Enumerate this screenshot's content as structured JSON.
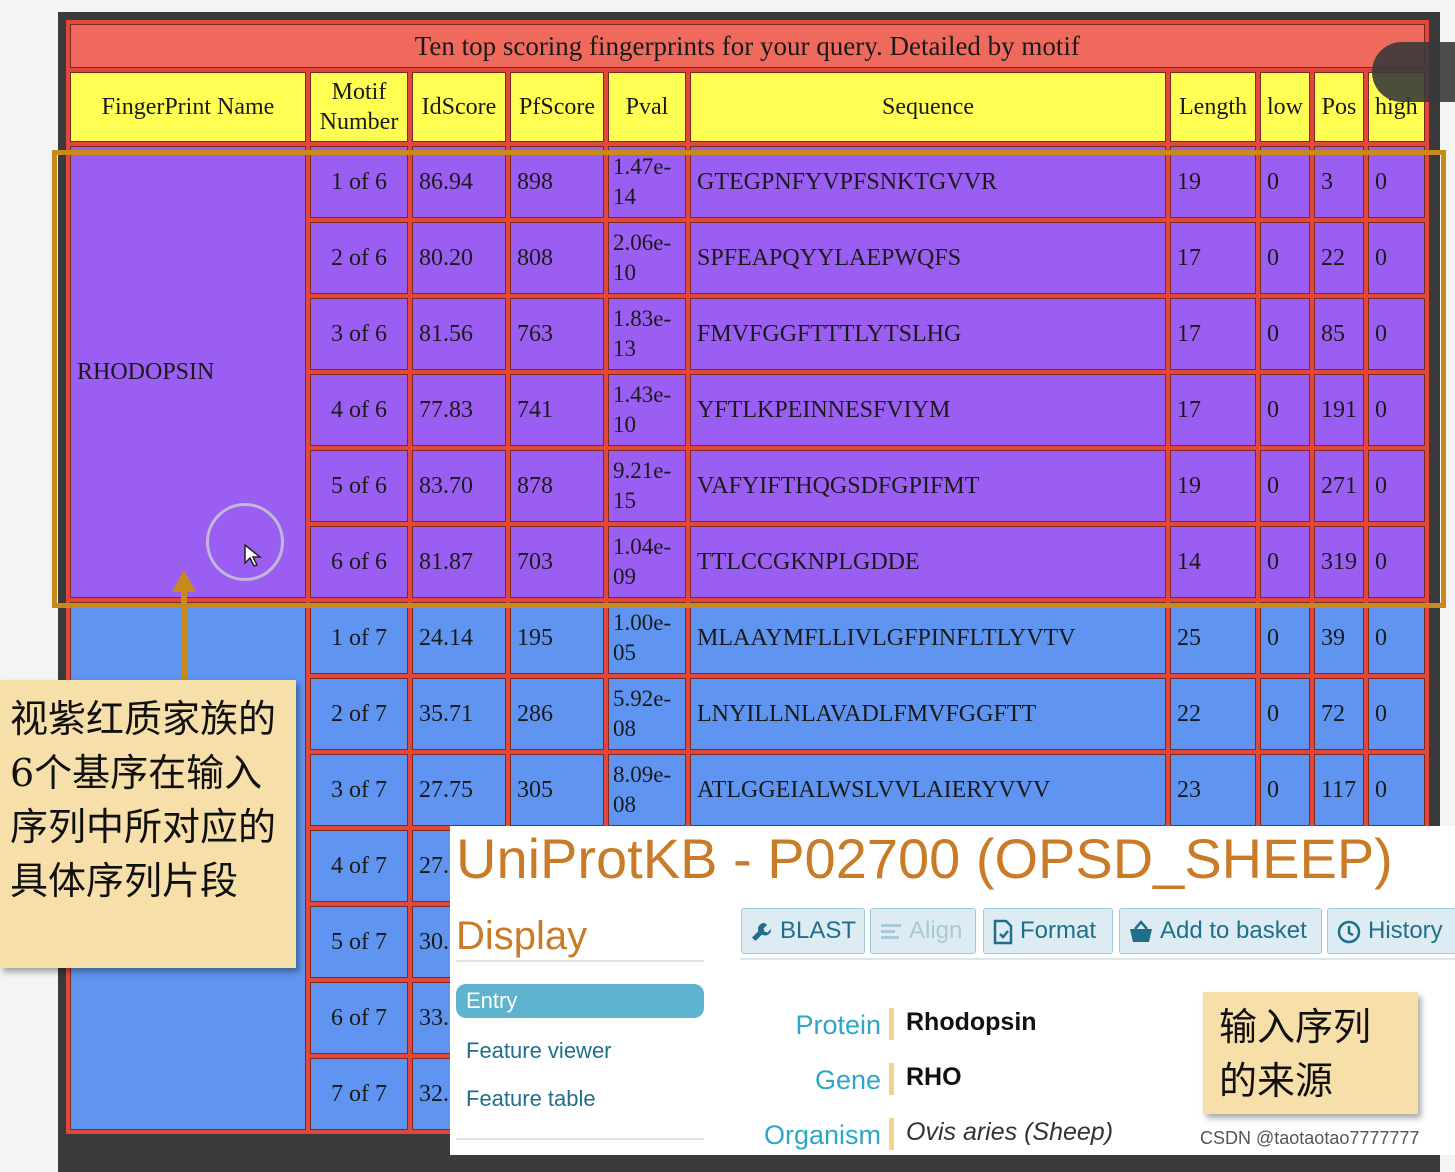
{
  "table": {
    "title": "Ten top scoring fingerprints for your query. Detailed by motif",
    "headers": [
      "FingerPrint Name",
      "Motif Number",
      "IdScore",
      "PfScore",
      "Pval",
      "Sequence",
      "Length",
      "low",
      "Pos",
      "high"
    ],
    "group1": {
      "name": "RHODOPSIN",
      "rows": [
        {
          "motif": "1 of 6",
          "idscore": "86.94",
          "pfscore": "898",
          "pval": "1.47e-14",
          "sequence": "GTEGPNFYVPFSNKTGVVR",
          "length": "19",
          "low": "0",
          "pos": "3",
          "high": "0"
        },
        {
          "motif": "2 of 6",
          "idscore": "80.20",
          "pfscore": "808",
          "pval": "2.06e-10",
          "sequence": "SPFEAPQYYLAEPWQFS",
          "length": "17",
          "low": "0",
          "pos": "22",
          "high": "0"
        },
        {
          "motif": "3 of 6",
          "idscore": "81.56",
          "pfscore": "763",
          "pval": "1.83e-13",
          "sequence": "FMVFGGFTTTLYTSLHG",
          "length": "17",
          "low": "0",
          "pos": "85",
          "high": "0"
        },
        {
          "motif": "4 of 6",
          "idscore": "77.83",
          "pfscore": "741",
          "pval": "1.43e-10",
          "sequence": "YFTLKPEINNESFVIYM",
          "length": "17",
          "low": "0",
          "pos": "191",
          "high": "0"
        },
        {
          "motif": "5 of 6",
          "idscore": "83.70",
          "pfscore": "878",
          "pval": "9.21e-15",
          "sequence": "VAFYIFTHQGSDFGPIFMT",
          "length": "19",
          "low": "0",
          "pos": "271",
          "high": "0"
        },
        {
          "motif": "6 of 6",
          "idscore": "81.87",
          "pfscore": "703",
          "pval": "1.04e-09",
          "sequence": "TTLCCGKNPLGDDE",
          "length": "14",
          "low": "0",
          "pos": "319",
          "high": "0"
        }
      ]
    },
    "group2": {
      "rows": [
        {
          "motif": "1 of 7",
          "idscore": "24.14",
          "pfscore": "195",
          "pval": "1.00e-05",
          "sequence": "MLAAYMFLLIVLGFPINFLTLYVTV",
          "length": "25",
          "low": "0",
          "pos": "39",
          "high": "0"
        },
        {
          "motif": "2 of 7",
          "idscore": "35.71",
          "pfscore": "286",
          "pval": "5.92e-08",
          "sequence": "LNYILLNLAVADLFMVFGGFTT",
          "length": "22",
          "low": "0",
          "pos": "72",
          "high": "0"
        },
        {
          "motif": "3 of 7",
          "idscore": "27.75",
          "pfscore": "305",
          "pval": "8.09e-08",
          "sequence": "ATLGGEIALWSLVVLAIERYVVV",
          "length": "23",
          "low": "0",
          "pos": "117",
          "high": "0"
        },
        {
          "motif": "4 of 7",
          "idscore": "27.",
          "pfscore": "",
          "pval": "",
          "sequence": "",
          "length": "",
          "low": "",
          "pos": "",
          "high": ""
        },
        {
          "motif": "5 of 7",
          "idscore": "30.",
          "pfscore": "",
          "pval": "",
          "sequence": "",
          "length": "",
          "low": "",
          "pos": "",
          "high": ""
        },
        {
          "motif": "6 of 7",
          "idscore": "33.",
          "pfscore": "",
          "pval": "",
          "sequence": "",
          "length": "",
          "low": "",
          "pos": "",
          "high": ""
        },
        {
          "motif": "7 of 7",
          "idscore": "32.",
          "pfscore": "",
          "pval": "",
          "sequence": "",
          "length": "",
          "low": "",
          "pos": "",
          "high": ""
        }
      ]
    }
  },
  "notes": {
    "left": "视紫红质家族的6个基序在输入序列中所对应的具体序列片段",
    "right": "输入序列的来源"
  },
  "uniprot": {
    "title": "UniProtKB - P02700 (OPSD_SHEEP)",
    "display_heading": "Display",
    "toolbar": {
      "blast": "BLAST",
      "align": "Align",
      "format": "Format",
      "basket": "Add to basket",
      "history": "History"
    },
    "nav": {
      "entry": "Entry",
      "feature_viewer": "Feature viewer",
      "feature_table": "Feature table"
    },
    "info": {
      "protein_label": "Protein",
      "protein_value": "Rhodopsin",
      "gene_label": "Gene",
      "gene_value": "RHO",
      "organism_label": "Organism",
      "organism_value": "Ovis aries (Sheep)"
    }
  },
  "watermark": "CSDN @taotaotao7777777",
  "colors": {
    "purple_row": "#9b5ef2",
    "blue_row": "#5f95f0",
    "header_yellow": "#fffe52",
    "title_red": "#ef6a5d",
    "highlight_orange": "#c98a1c",
    "uniprot_orange": "#c97b28",
    "uniprot_blue": "#2ea6c9"
  }
}
